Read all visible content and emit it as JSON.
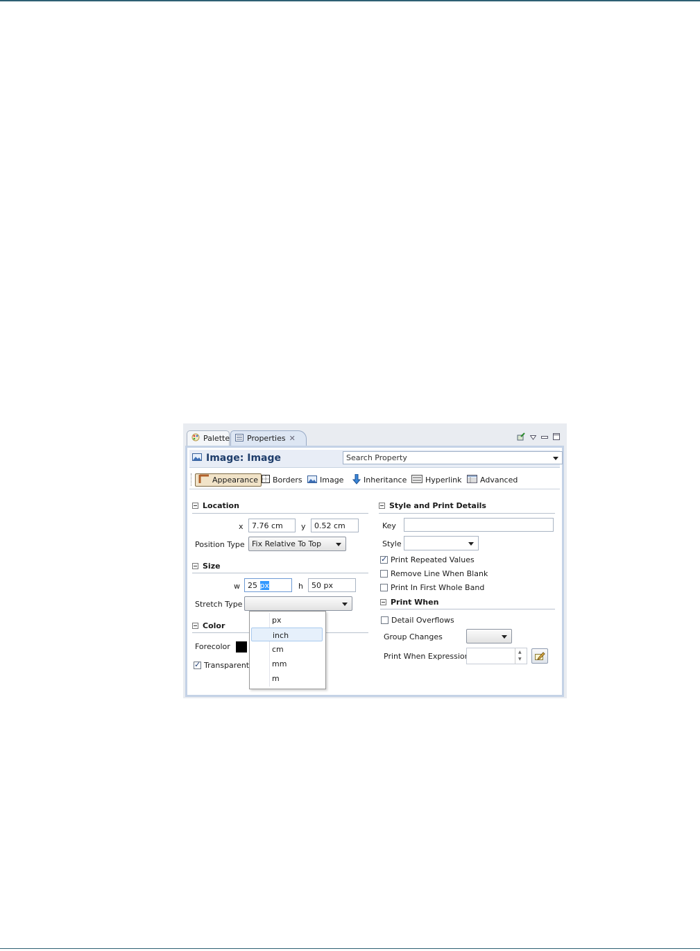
{
  "view": {
    "tabs": [
      {
        "label": "Palette",
        "icon": "palette-icon"
      },
      {
        "label": "Properties",
        "icon": "properties-icon",
        "close_icon": "close-icon"
      }
    ]
  },
  "header": {
    "title": "Image: Image",
    "icon": "image-icon",
    "search_placeholder": "Search Property"
  },
  "toolbar": {
    "buttons": [
      {
        "label": "Appearance",
        "icon": "appearance-icon",
        "active": true
      },
      {
        "label": "Borders",
        "icon": "borders-icon"
      },
      {
        "label": "Image",
        "icon": "image-icon"
      },
      {
        "label": "Inheritance",
        "icon": "inheritance-icon"
      },
      {
        "label": "Hyperlink",
        "icon": "hyperlink-icon"
      },
      {
        "label": "Advanced",
        "icon": "advanced-icon"
      }
    ]
  },
  "location": {
    "title": "Location",
    "x_label": "x",
    "x_value": "7.76 cm",
    "y_label": "y",
    "y_value": "0.52 cm",
    "position_type_label": "Position Type",
    "position_type_value": "Fix Relative To Top"
  },
  "size": {
    "title": "Size",
    "w_label": "w",
    "w_number": "25",
    "w_unit": "px",
    "h_label": "h",
    "h_value": "50 px",
    "stretch_type_label": "Stretch Type"
  },
  "unit_menu": {
    "options": [
      "px",
      "inch",
      "cm",
      "mm",
      "m"
    ],
    "selected": "inch"
  },
  "color": {
    "title": "Color",
    "forecolor_label": "Forecolor",
    "forecolor_value": "#000000",
    "transparent_label": "Transparent",
    "transparent_checked": true
  },
  "style_print": {
    "title": "Style and Print Details",
    "key_label": "Key",
    "key_value": "",
    "style_label": "Style",
    "style_value": "",
    "checks": [
      {
        "label": "Print Repeated Values",
        "checked": true
      },
      {
        "label": "Remove Line When Blank",
        "checked": false
      },
      {
        "label": "Print In First Whole Band",
        "checked": false
      }
    ]
  },
  "print_when": {
    "title": "Print When",
    "detail_overflows_label": "Detail Overflows",
    "detail_overflows_checked": false,
    "group_changes_label": "Group Changes",
    "expression_label": "Print When Expression"
  }
}
